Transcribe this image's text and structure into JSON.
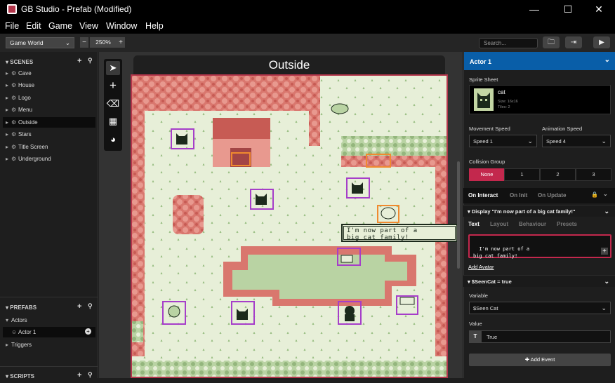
{
  "window": {
    "title": "GB Studio - Prefab (Modified)",
    "controls": [
      "—",
      "☐",
      "✕"
    ]
  },
  "menu": [
    "File",
    "Edit",
    "Game",
    "View",
    "Window",
    "Help"
  ],
  "toolbar": {
    "world_select": "Game World",
    "zoom": "250%",
    "search_placeholder": "Search...",
    "zoom_out": "−",
    "zoom_in": "+"
  },
  "scenes_panel": {
    "title": "SCENES",
    "items": [
      "Cave",
      "House",
      "Logo",
      "Menu",
      "Outside",
      "Stars",
      "Title Screen",
      "Underground"
    ],
    "active": "Outside"
  },
  "prefabs_panel": {
    "title": "PREFABS",
    "actors_label": "Actors",
    "actor_item": "Actor 1",
    "triggers_label": "Triggers"
  },
  "scripts_panel": {
    "title": "SCRIPTS"
  },
  "scene": {
    "name": "Outside",
    "dialogue": "I'm now part of a\nbig cat family!"
  },
  "inspector": {
    "header": "Actor 1",
    "sprite_sheet_label": "Sprite Sheet",
    "sprite_name": "cat",
    "sprite_size": "Size: 16x16",
    "sprite_tiles": "Tiles: 2",
    "movement_speed_label": "Movement Speed",
    "movement_speed": "Speed 1",
    "animation_speed_label": "Animation Speed",
    "animation_speed": "Speed 4",
    "collision_group_label": "Collision Group",
    "collision_options": [
      "None",
      "1",
      "2",
      "3"
    ],
    "collision_selected": "None",
    "event_tabs": [
      "On Interact",
      "On Init",
      "On Update"
    ],
    "event_tab_active": "On Interact",
    "display_header": "Display \"I'm now part of a big cat family!\"",
    "sub_tabs": [
      "Text",
      "Layout",
      "Behaviour",
      "Presets"
    ],
    "sub_tab_active": "Text",
    "text_value": "I'm now part of a\nbig cat family!",
    "add_avatar": "Add Avatar",
    "condition_header": "$SeenCat = true",
    "variable_label": "Variable",
    "variable_value": "$Seen Cat",
    "value_label": "Value",
    "value_type": "T",
    "value_value": "True",
    "add_event": "Add Event"
  },
  "colors": {
    "accent_blue": "#095ea8",
    "accent_pink": "#c3284d",
    "scene_border": "#b3364b",
    "gb_light": "#e7efd8",
    "gb_red": "#d9776e",
    "gb_dark": "#1c2a1c"
  }
}
